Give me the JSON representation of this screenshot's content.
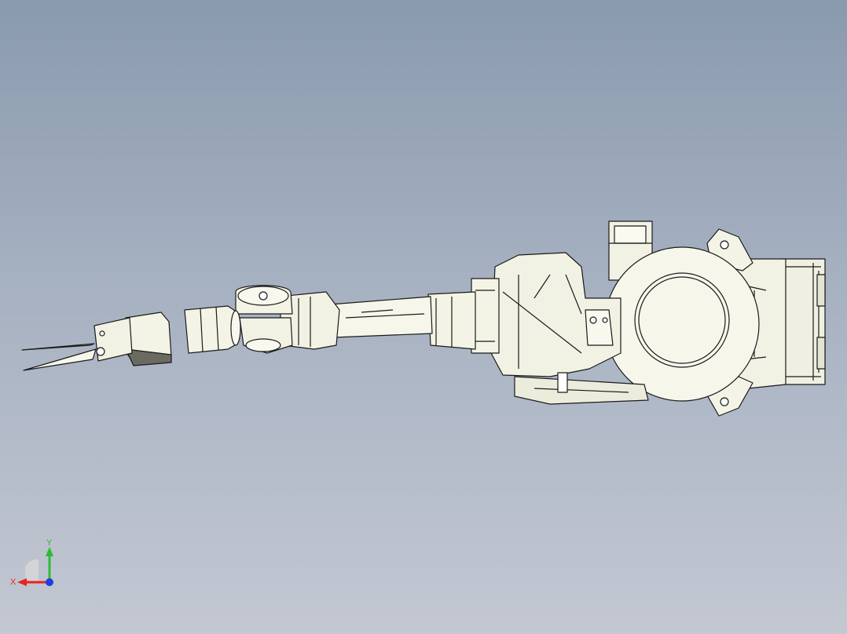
{
  "viewport": {
    "background_top": "#8a9aae",
    "background_bottom": "#c3c8d2"
  },
  "model": {
    "part_color": "#f4f4e6",
    "part_shade": "#d8d8c6",
    "edge_color": "#1a1a1a",
    "dark_shade": "#6a6a60"
  },
  "triad": {
    "x_label": "X",
    "y_label": "Y",
    "x_color": "#e8251f",
    "y_color": "#2dbb34",
    "z_color": "#1f3de0"
  }
}
